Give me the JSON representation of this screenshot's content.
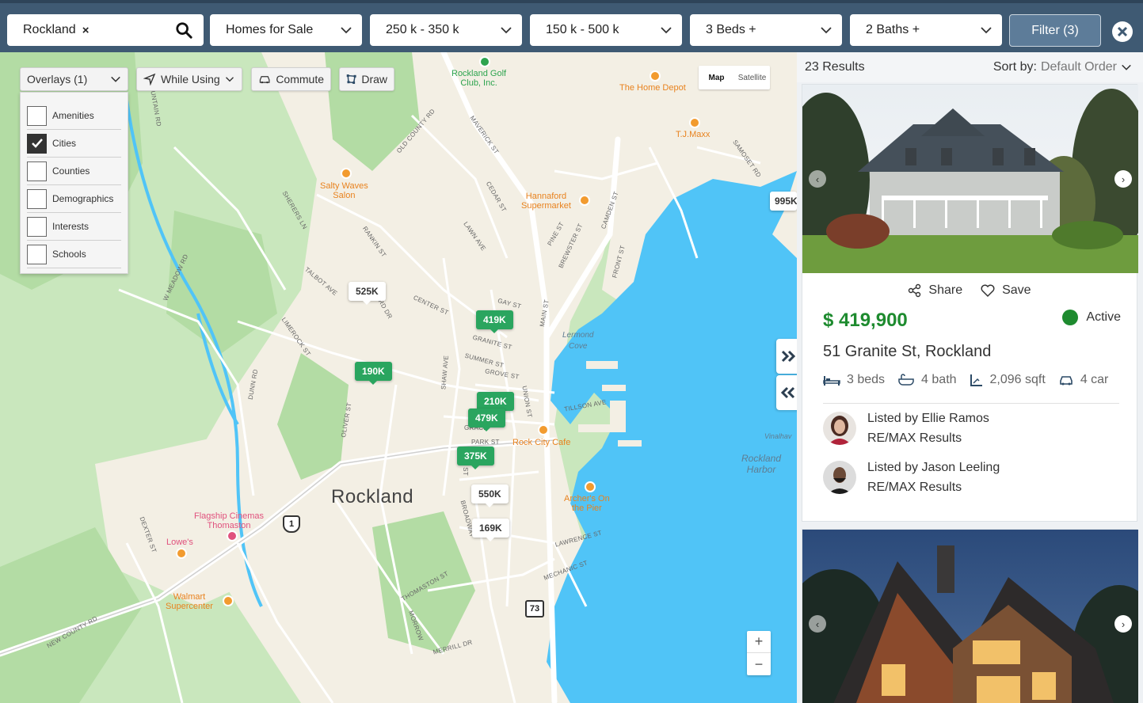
{
  "search": {
    "value": "Rockland",
    "clear_glyph": "×"
  },
  "filters": {
    "listing_type": "Homes for Sale",
    "price_range": "250 k - 350 k",
    "second_range": "150 k - 500 k",
    "beds": "3 Beds +",
    "baths": "2 Baths +",
    "filter_button": "Filter (3)"
  },
  "map_controls": {
    "overlays": "Overlays (1)",
    "while_using": "While Using",
    "commute": "Commute",
    "draw": "Draw",
    "map": "Map",
    "satellite": "Satellite",
    "zoom_in": "+",
    "zoom_out": "−"
  },
  "overlays": [
    {
      "label": "Amenities",
      "checked": false
    },
    {
      "label": "Cities",
      "checked": true
    },
    {
      "label": "Counties",
      "checked": false
    },
    {
      "label": "Demographics",
      "checked": false
    },
    {
      "label": "Interests",
      "checked": false
    },
    {
      "label": "Schools",
      "checked": false
    }
  ],
  "map": {
    "city": "Rockland",
    "water_cove": "Lermond\nCove",
    "water_harbor": "Rockland\nHarbor",
    "water_edge": "Vinalhav",
    "pois": {
      "golf": "Rockland Golf\nClub, Inc.",
      "home_depot": "The Home Depot",
      "tjmaxx": "T.J.Maxx",
      "salty": "Salty Waves\nSalon",
      "hannaford": "Hannaford\nSupermarket",
      "rock_city": "Rock City Cafe",
      "archers": "Archer's On\nthe Pier",
      "flagship": "Flagship Cinemas\nThomaston",
      "lowes": "Lowe's",
      "walmart": "Walmart\nSupercenter"
    },
    "streets": {
      "mountain": "MOUNTAIN RD",
      "old_county": "OLD COUNTY RD",
      "maverick": "MAVERICK ST",
      "samoset": "SAMOSET RD",
      "cedar": "CEDAR ST",
      "pine": "PINE ST",
      "camden": "CAMDEN ST",
      "lawn": "LAWN AVE",
      "brewster": "BREWSTER ST",
      "front": "FRONT ST",
      "sherers": "SHERERS LN",
      "rankin": "RANKIN ST",
      "w_meadow": "W MEADOW RD",
      "talbot": "TALBOT AVE",
      "center": "CENTER ST",
      "gay": "GAY ST",
      "main": "MAIN ST",
      "granite": "GRANITE ST",
      "limerock": "LIMEROCK ST",
      "summer": "SUMMER ST",
      "grove": "GROVE ST",
      "shaw": "SHAW AVE",
      "union": "UNION ST",
      "tillson": "TILLSON AVE",
      "dunn": "DUNN RD",
      "oliver": "OLIVER ST",
      "park": "PARK ST",
      "dexter": "DEXTER ST",
      "broadway": "BROADWAY",
      "lawrence": "LAWRENCE ST",
      "mechanic": "MECHANIC ST",
      "thomaston": "THOMASTON ST",
      "new_county": "NEW COUNTY RD",
      "merrill": "MERRILL DR",
      "rd_dr": "RD DR",
      "st": "ST",
      "gracel": "GRACE",
      "morrow": "MORROW"
    },
    "shield_us1": "1",
    "shield_73": "73",
    "pins": [
      {
        "label": "525K",
        "style": "white"
      },
      {
        "label": "419K",
        "style": "green"
      },
      {
        "label": "190K",
        "style": "green"
      },
      {
        "label": "210K",
        "style": "green"
      },
      {
        "label": "479K",
        "style": "green"
      },
      {
        "label": "375K",
        "style": "green"
      },
      {
        "label": "550K",
        "style": "white"
      },
      {
        "label": "169K",
        "style": "white"
      },
      {
        "label": "995K",
        "style": "white"
      }
    ]
  },
  "results": {
    "count": "23 Results",
    "sort_label": "Sort by:",
    "sort_value": "Default Order"
  },
  "listing": {
    "share": "Share",
    "save": "Save",
    "price": "$ 419,900",
    "status": "Active",
    "address": "51 Granite St, Rockland",
    "beds": "3 beds",
    "bath": "4 bath",
    "sqft": "2,096 sqft",
    "car": "4 car",
    "agents": [
      {
        "name": "Listed by Ellie Ramos",
        "office": "RE/MAX Results"
      },
      {
        "name": "Listed by Jason Leeling",
        "office": "RE/MAX Results"
      }
    ]
  },
  "colors": {
    "topbar": "#3f5a73",
    "price": "#1e8b2f",
    "pin_green": "#2aa55f",
    "water": "#50c4f7",
    "land": "#c9e7bd"
  }
}
